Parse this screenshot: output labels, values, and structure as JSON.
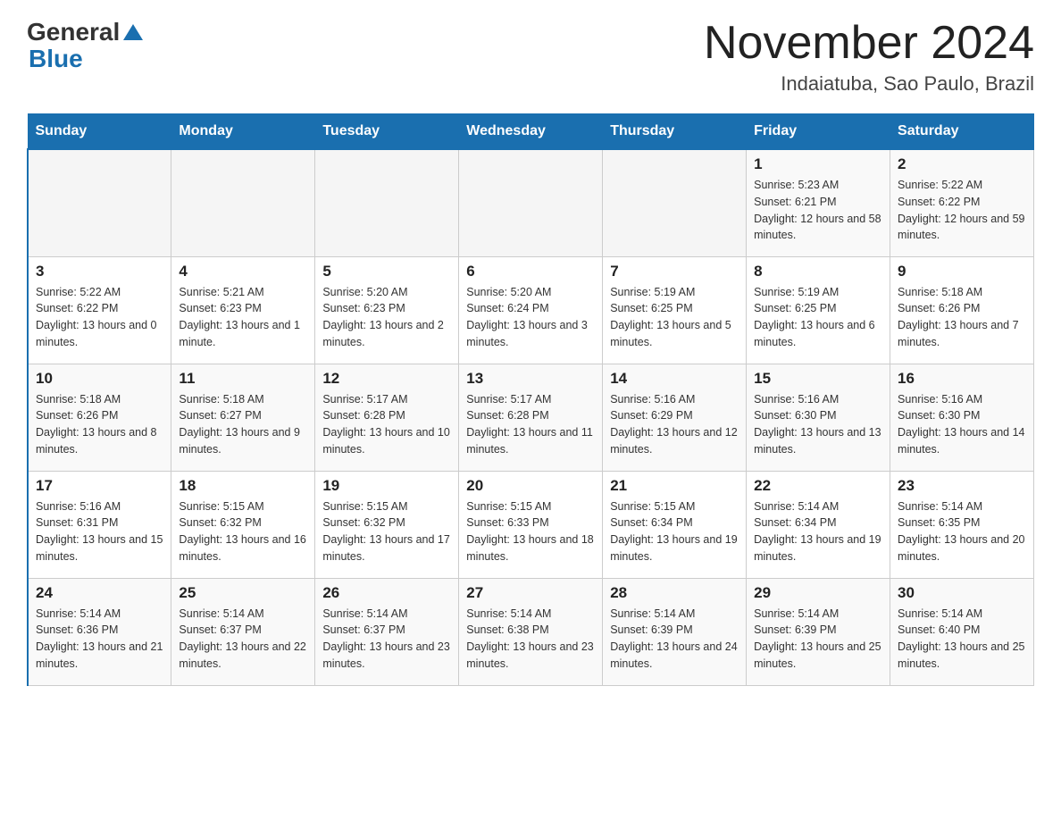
{
  "header": {
    "logo_general": "General",
    "logo_blue": "Blue",
    "title": "November 2024",
    "subtitle": "Indaiatuba, Sao Paulo, Brazil"
  },
  "days_of_week": [
    "Sunday",
    "Monday",
    "Tuesday",
    "Wednesday",
    "Thursday",
    "Friday",
    "Saturday"
  ],
  "weeks": [
    {
      "days": [
        {
          "number": "",
          "info": ""
        },
        {
          "number": "",
          "info": ""
        },
        {
          "number": "",
          "info": ""
        },
        {
          "number": "",
          "info": ""
        },
        {
          "number": "",
          "info": ""
        },
        {
          "number": "1",
          "info": "Sunrise: 5:23 AM\nSunset: 6:21 PM\nDaylight: 12 hours and 58 minutes."
        },
        {
          "number": "2",
          "info": "Sunrise: 5:22 AM\nSunset: 6:22 PM\nDaylight: 12 hours and 59 minutes."
        }
      ]
    },
    {
      "days": [
        {
          "number": "3",
          "info": "Sunrise: 5:22 AM\nSunset: 6:22 PM\nDaylight: 13 hours and 0 minutes."
        },
        {
          "number": "4",
          "info": "Sunrise: 5:21 AM\nSunset: 6:23 PM\nDaylight: 13 hours and 1 minute."
        },
        {
          "number": "5",
          "info": "Sunrise: 5:20 AM\nSunset: 6:23 PM\nDaylight: 13 hours and 2 minutes."
        },
        {
          "number": "6",
          "info": "Sunrise: 5:20 AM\nSunset: 6:24 PM\nDaylight: 13 hours and 3 minutes."
        },
        {
          "number": "7",
          "info": "Sunrise: 5:19 AM\nSunset: 6:25 PM\nDaylight: 13 hours and 5 minutes."
        },
        {
          "number": "8",
          "info": "Sunrise: 5:19 AM\nSunset: 6:25 PM\nDaylight: 13 hours and 6 minutes."
        },
        {
          "number": "9",
          "info": "Sunrise: 5:18 AM\nSunset: 6:26 PM\nDaylight: 13 hours and 7 minutes."
        }
      ]
    },
    {
      "days": [
        {
          "number": "10",
          "info": "Sunrise: 5:18 AM\nSunset: 6:26 PM\nDaylight: 13 hours and 8 minutes."
        },
        {
          "number": "11",
          "info": "Sunrise: 5:18 AM\nSunset: 6:27 PM\nDaylight: 13 hours and 9 minutes."
        },
        {
          "number": "12",
          "info": "Sunrise: 5:17 AM\nSunset: 6:28 PM\nDaylight: 13 hours and 10 minutes."
        },
        {
          "number": "13",
          "info": "Sunrise: 5:17 AM\nSunset: 6:28 PM\nDaylight: 13 hours and 11 minutes."
        },
        {
          "number": "14",
          "info": "Sunrise: 5:16 AM\nSunset: 6:29 PM\nDaylight: 13 hours and 12 minutes."
        },
        {
          "number": "15",
          "info": "Sunrise: 5:16 AM\nSunset: 6:30 PM\nDaylight: 13 hours and 13 minutes."
        },
        {
          "number": "16",
          "info": "Sunrise: 5:16 AM\nSunset: 6:30 PM\nDaylight: 13 hours and 14 minutes."
        }
      ]
    },
    {
      "days": [
        {
          "number": "17",
          "info": "Sunrise: 5:16 AM\nSunset: 6:31 PM\nDaylight: 13 hours and 15 minutes."
        },
        {
          "number": "18",
          "info": "Sunrise: 5:15 AM\nSunset: 6:32 PM\nDaylight: 13 hours and 16 minutes."
        },
        {
          "number": "19",
          "info": "Sunrise: 5:15 AM\nSunset: 6:32 PM\nDaylight: 13 hours and 17 minutes."
        },
        {
          "number": "20",
          "info": "Sunrise: 5:15 AM\nSunset: 6:33 PM\nDaylight: 13 hours and 18 minutes."
        },
        {
          "number": "21",
          "info": "Sunrise: 5:15 AM\nSunset: 6:34 PM\nDaylight: 13 hours and 19 minutes."
        },
        {
          "number": "22",
          "info": "Sunrise: 5:14 AM\nSunset: 6:34 PM\nDaylight: 13 hours and 19 minutes."
        },
        {
          "number": "23",
          "info": "Sunrise: 5:14 AM\nSunset: 6:35 PM\nDaylight: 13 hours and 20 minutes."
        }
      ]
    },
    {
      "days": [
        {
          "number": "24",
          "info": "Sunrise: 5:14 AM\nSunset: 6:36 PM\nDaylight: 13 hours and 21 minutes."
        },
        {
          "number": "25",
          "info": "Sunrise: 5:14 AM\nSunset: 6:37 PM\nDaylight: 13 hours and 22 minutes."
        },
        {
          "number": "26",
          "info": "Sunrise: 5:14 AM\nSunset: 6:37 PM\nDaylight: 13 hours and 23 minutes."
        },
        {
          "number": "27",
          "info": "Sunrise: 5:14 AM\nSunset: 6:38 PM\nDaylight: 13 hours and 23 minutes."
        },
        {
          "number": "28",
          "info": "Sunrise: 5:14 AM\nSunset: 6:39 PM\nDaylight: 13 hours and 24 minutes."
        },
        {
          "number": "29",
          "info": "Sunrise: 5:14 AM\nSunset: 6:39 PM\nDaylight: 13 hours and 25 minutes."
        },
        {
          "number": "30",
          "info": "Sunrise: 5:14 AM\nSunset: 6:40 PM\nDaylight: 13 hours and 25 minutes."
        }
      ]
    }
  ]
}
